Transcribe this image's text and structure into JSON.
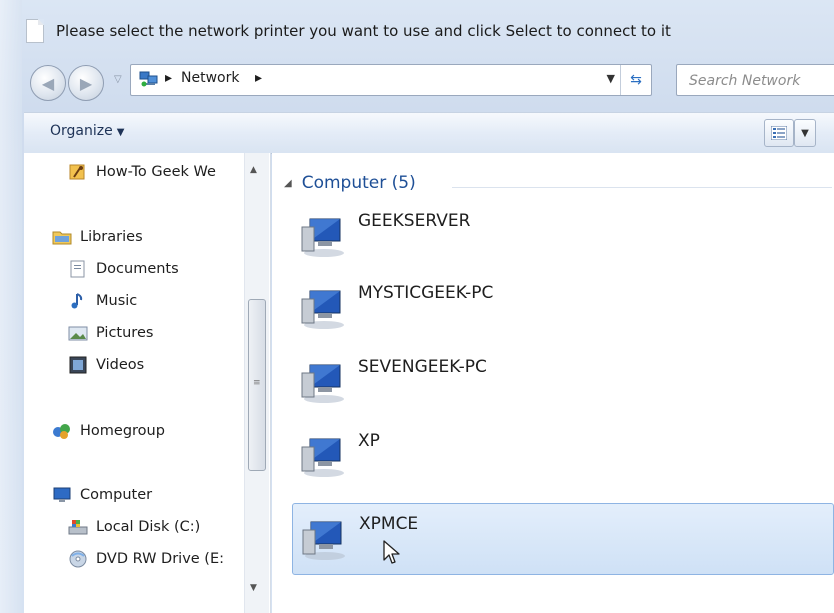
{
  "window": {
    "title": "Please select the network printer you want to use and click Select to connect to it"
  },
  "addressbar": {
    "location_icon": "network-icon",
    "breadcrumb": [
      "Network"
    ],
    "search_placeholder": "Search Network"
  },
  "toolbar": {
    "organize_label": "Organize",
    "view_icon": "details-view-icon"
  },
  "sidebar": {
    "items": [
      {
        "label": "How-To Geek We",
        "icon": "favorite-link-icon"
      },
      {
        "label": "Libraries",
        "icon": "libraries-icon"
      },
      {
        "label": "Documents",
        "icon": "documents-icon"
      },
      {
        "label": "Music",
        "icon": "music-icon"
      },
      {
        "label": "Pictures",
        "icon": "pictures-icon"
      },
      {
        "label": "Videos",
        "icon": "videos-icon"
      },
      {
        "label": "Homegroup",
        "icon": "homegroup-icon"
      },
      {
        "label": "Computer",
        "icon": "computer-icon"
      },
      {
        "label": "Local Disk (C:)",
        "icon": "local-disk-icon"
      },
      {
        "label": "DVD RW Drive (E:",
        "icon": "dvd-drive-icon"
      }
    ]
  },
  "content": {
    "group_label": "Computer (5)",
    "computers": [
      {
        "name": "GEEKSERVER"
      },
      {
        "name": "MYSTICGEEK-PC"
      },
      {
        "name": "SEVENGEEK-PC"
      },
      {
        "name": "XP"
      },
      {
        "name": "XPMCE"
      }
    ],
    "selected_index": 4
  },
  "colors": {
    "group_header": "#1e4f96",
    "selection_fill": "#d6e6f8",
    "selection_border": "#8eb4e3",
    "chrome": "#d6e2f2"
  }
}
